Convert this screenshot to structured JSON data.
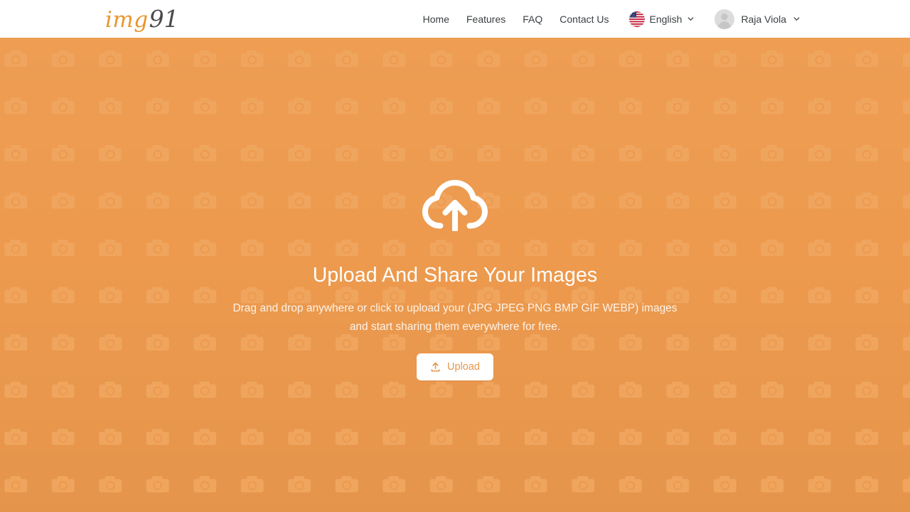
{
  "header": {
    "brand": {
      "part1": "img",
      "part2": "91"
    },
    "nav": [
      {
        "label": "Home",
        "name": "nav-link-home"
      },
      {
        "label": "Features",
        "name": "nav-link-features"
      },
      {
        "label": "FAQ",
        "name": "nav-link-faq"
      },
      {
        "label": "Contact Us",
        "name": "nav-link-contact-us"
      }
    ],
    "language": {
      "label": "English",
      "flag_icon": "us-flag-icon",
      "chevron_icon": "chevron-down-icon"
    },
    "user": {
      "name": "Raja Viola",
      "avatar_icon": "avatar-placeholder-icon",
      "chevron_icon": "chevron-down-icon"
    }
  },
  "hero": {
    "cloud_icon": "cloud-upload-icon",
    "title": "Upload And Share Your Images",
    "subtitle": "Drag and drop anywhere or click to upload your (JPG JPEG PNG BMP GIF WEBP) images and start sharing them everywhere for free.",
    "upload_button": {
      "label": "Upload",
      "icon": "upload-icon"
    },
    "background_pattern_icon": "camera-icon"
  },
  "colors": {
    "hero_background": "#ED9A4E",
    "pattern_icon": "#F0A55E",
    "brand_orange": "#E8962F",
    "brand_dark": "#4A4A4A",
    "nav_text": "#3C4043",
    "button_text": "#E8964A",
    "button_background": "#FFFFFF",
    "hero_title": "#FFFFFF",
    "hero_subtitle": "#FDF3E8"
  }
}
